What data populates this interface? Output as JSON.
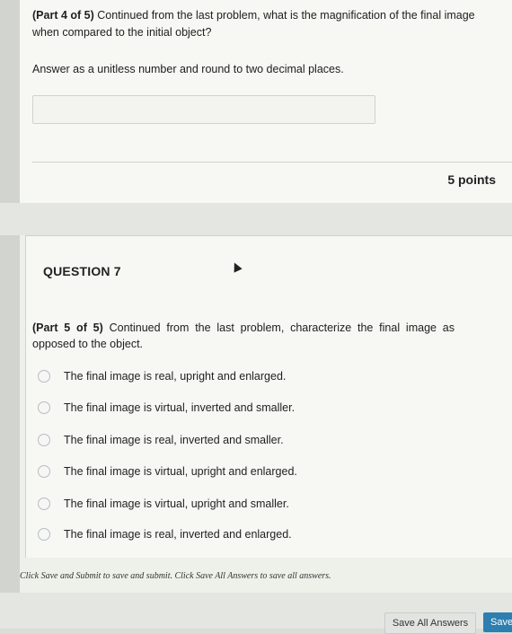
{
  "question_part4": {
    "part_label": "(Part 4 of 5)",
    "prompt": "Continued from the last problem, what is the magnification of the final image when compared to the initial object?",
    "instructions": "Answer as a unitless number and round to two decimal places.",
    "answer_value": "",
    "points": "5 points"
  },
  "question7": {
    "number_label": "QUESTION 7",
    "part_label": "(Part 5 of 5)",
    "prompt": "Continued from the last problem, characterize the final image as opposed to the object.",
    "options": [
      "The final image is real, upright and enlarged.",
      "The final image is virtual, inverted and smaller.",
      "The final image is real, inverted and smaller.",
      "The final image is virtual, upright and enlarged.",
      "The final image is virtual, upright and smaller.",
      "The final image is real, inverted and enlarged."
    ]
  },
  "footer": {
    "note": "Click Save and Submit to save and submit. Click Save All Answers to save all answers.",
    "save_all_label": "Save All Answers",
    "save_label": "Save"
  }
}
